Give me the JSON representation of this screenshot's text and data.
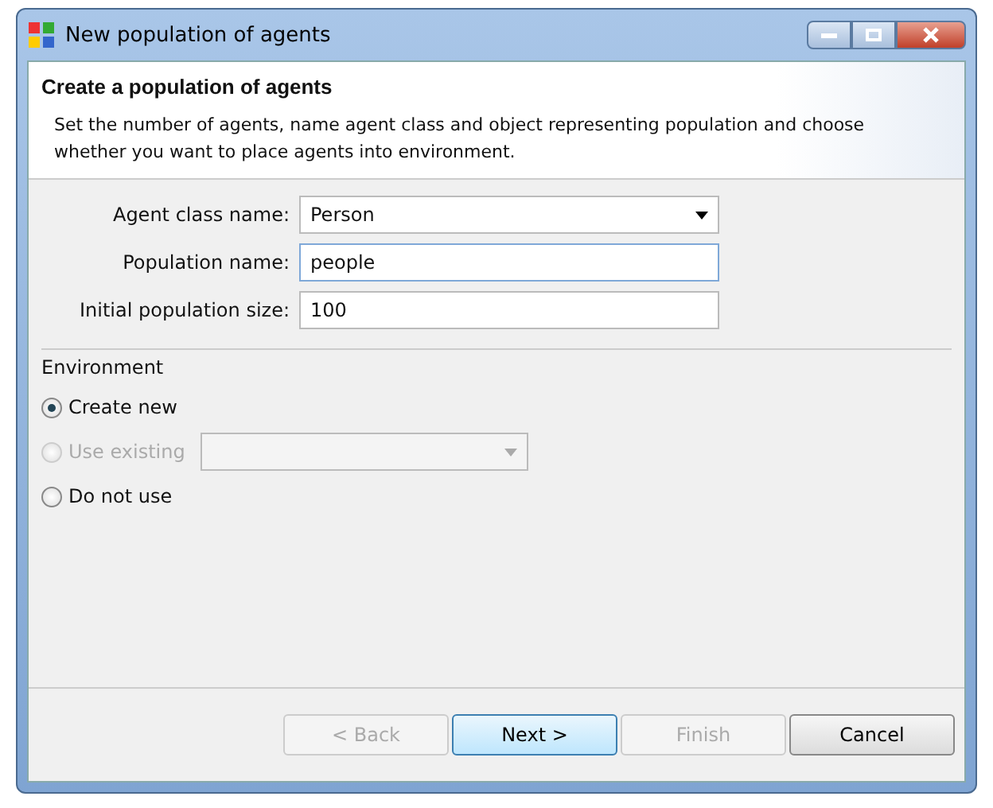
{
  "window": {
    "title": "New population of agents"
  },
  "header": {
    "title": "Create a population of agents",
    "description": "Set the number of agents, name agent class and object representing population and choose whether you want to place agents into environment."
  },
  "fields": [
    {
      "label": "Agent class name:",
      "value": "Person",
      "kind": "combo",
      "focused": false
    },
    {
      "label": "Population name:",
      "value": "people",
      "kind": "text",
      "focused": true
    },
    {
      "label": "Initial population size:",
      "value": "100",
      "kind": "text",
      "focused": false
    }
  ],
  "environment": {
    "title": "Environment",
    "options": [
      {
        "label": "Create new",
        "selected": true,
        "disabled": false,
        "kind": "plain"
      },
      {
        "label": "Use existing",
        "selected": false,
        "disabled": true,
        "kind": "combo"
      },
      {
        "label": "Do not use",
        "selected": false,
        "disabled": false,
        "kind": "plain"
      }
    ]
  },
  "buttons": [
    {
      "label": "< Back",
      "disabled": true,
      "default": false
    },
    {
      "label": "Next >",
      "disabled": false,
      "default": true
    },
    {
      "label": "Finish",
      "disabled": true,
      "default": false
    },
    {
      "label": "Cancel",
      "disabled": false,
      "default": false
    }
  ]
}
